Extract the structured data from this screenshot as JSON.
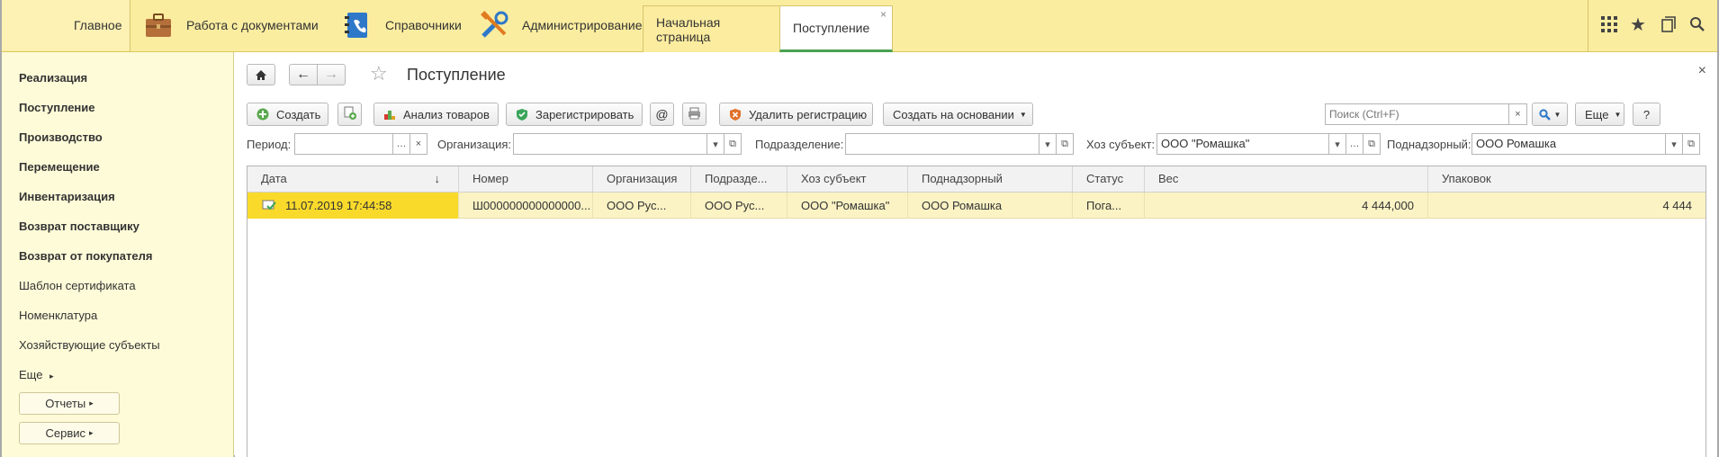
{
  "topbar": {
    "sections": [
      {
        "label": "Главное",
        "icon": "logo-icon"
      },
      {
        "label": "Работа с документами",
        "icon": "briefcase-icon"
      },
      {
        "label": "Справочники",
        "icon": "address-book-icon"
      },
      {
        "label": "Администрирование",
        "icon": "tools-icon"
      }
    ],
    "open_tabs": [
      {
        "label": "Начальная страница"
      },
      {
        "label": "Поступление",
        "close": "×"
      }
    ]
  },
  "sidebar": {
    "items": [
      {
        "label": "Реализация"
      },
      {
        "label": "Поступление"
      },
      {
        "label": "Производство"
      },
      {
        "label": "Перемещение"
      },
      {
        "label": "Инвентаризация"
      },
      {
        "label": "Возврат поставщику"
      },
      {
        "label": "Возврат от покупателя"
      },
      {
        "label": "Шаблон сертификата"
      },
      {
        "label": "Номенклатура"
      },
      {
        "label": "Хозяйствующие субъекты"
      },
      {
        "label": "Еще"
      }
    ],
    "reports_label": "Отчеты",
    "service_label": "Сервис"
  },
  "form": {
    "title": "Поступление",
    "close": "×",
    "toolbar": {
      "create": "Создать",
      "analysis": "Анализ товаров",
      "register": "Зарегистрировать",
      "at": "@",
      "delete_reg": "Удалить регистрацию",
      "create_based": "Создать на основании",
      "search_placeholder": "Поиск (Ctrl+F)",
      "more": "Еще",
      "help": "?"
    },
    "filters": {
      "period_label": "Период:",
      "period_value": "",
      "org_label": "Организация:",
      "org_value": "",
      "dept_label": "Подразделение:",
      "dept_value": "",
      "subject_label": "Хоз субъект:",
      "subject_value": "ООО \"Ромашка\"",
      "supervised_label": "Поднадзорный:",
      "supervised_value": "ООО  Ромашка"
    }
  },
  "table": {
    "columns": [
      "Дата",
      "Номер",
      "Организация",
      "Подразде...",
      "Хоз субъект",
      "Поднадзорный",
      "Статус",
      "Вес",
      "Упаковок"
    ],
    "sort_indicator": "↓",
    "rows": [
      [
        "11.07.2019 17:44:58",
        "Ш000000000000000...",
        "ООО Рус...",
        "ООО Рус...",
        "ООО \"Ромашка\"",
        "ООО  Ромашка",
        "Пога...",
        "4 444,000",
        "4 444"
      ]
    ]
  },
  "colors": {
    "accent": "#fbeda0",
    "selected_row": "#f9da2b",
    "sidebar_bg": "#fefbd8"
  }
}
